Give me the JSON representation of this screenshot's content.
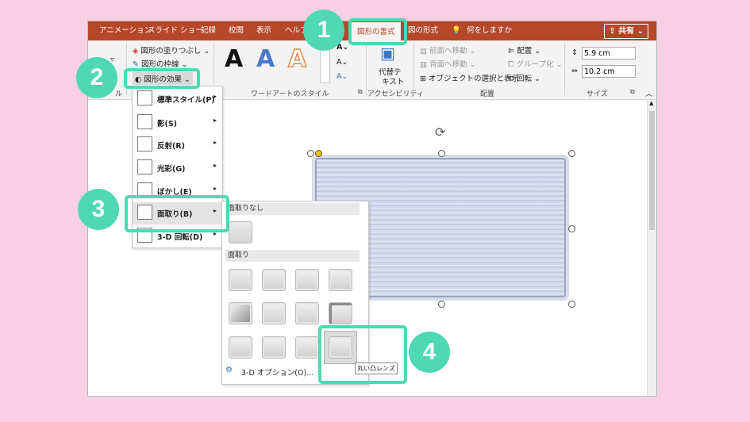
{
  "tabs": [
    "アニメーション",
    "スライド ショー",
    "記録",
    "校閲",
    "表示",
    "ヘルプ",
    "図形の書式",
    "図の形式"
  ],
  "tell_me": "何をしますか",
  "share": "共有",
  "ribbon": {
    "shape_fill": "図形の塗りつぶし",
    "shape_outline": "図形の枠線",
    "shape_effects": "図形の効果",
    "wordart_label": "ワードアートのスタイル",
    "wordart_letter": "A",
    "alt_text_line1": "代替テ",
    "alt_text_line2": "キスト",
    "accessibility_label": "アクセシビリティ",
    "bring_forward": "前面へ移動",
    "send_backward": "背面へ移動",
    "selection_pane": "オブジェクトの選択と表示",
    "align": "配置",
    "group": "グループ化",
    "rotate": "回転",
    "arrange_label": "配置",
    "height": "5.9 cm",
    "width": "10.2 cm",
    "size_label": "サイズ",
    "left_partial": "ル"
  },
  "menu1": [
    "標準スタイル(P)",
    "影(S)",
    "反射(R)",
    "光彩(G)",
    "ぼかし(E)",
    "面取り(B)",
    "3-D 回転(D)"
  ],
  "menu2": {
    "no_bevel_header": "面取りなし",
    "bevel_header": "面取り",
    "options": "3-D オプション(O)...",
    "tooltip": "丸い凸レンズ"
  },
  "steps": [
    "1",
    "2",
    "3",
    "4"
  ],
  "colors": {
    "accent": "#4fd9b3",
    "tabbar": "#b7472a",
    "background": "#f9cfe3"
  }
}
